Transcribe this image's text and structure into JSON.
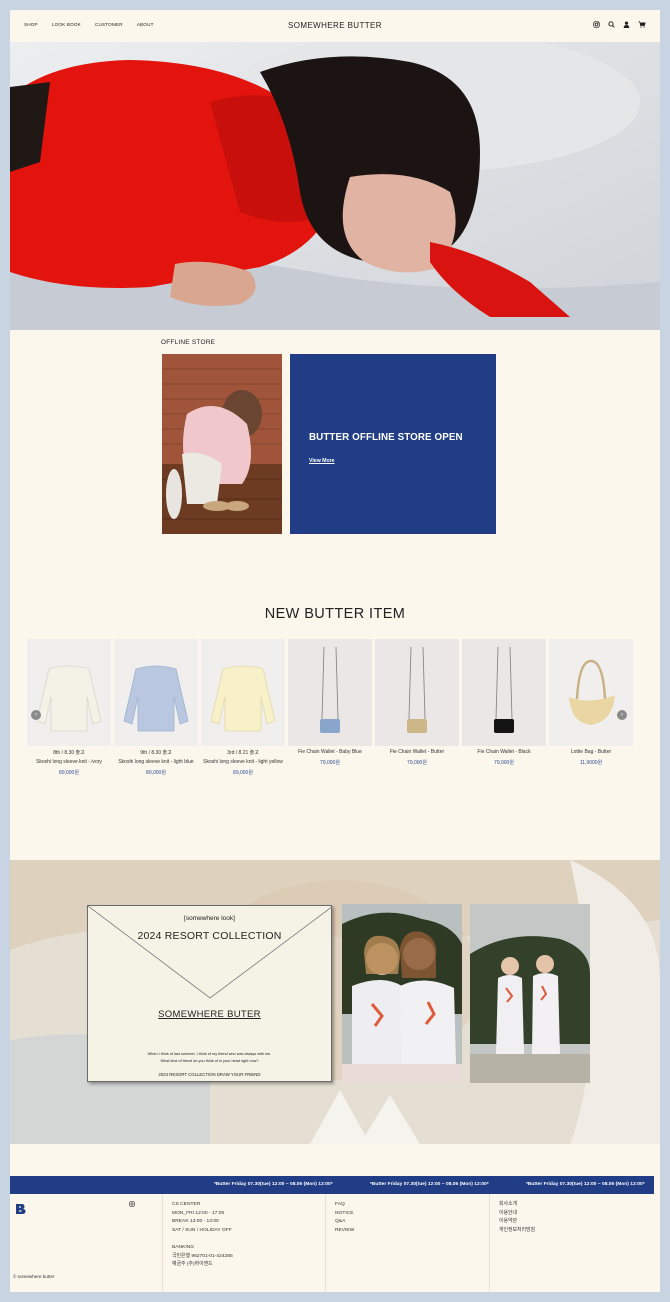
{
  "header": {
    "nav": [
      "SHOP",
      "LOOK BOOK",
      "CUSTOMER",
      "ABOUT"
    ],
    "brand": "SOMEWHERE BUTTER",
    "icons": [
      "instagram-icon",
      "search-icon",
      "user-icon",
      "cart-icon"
    ]
  },
  "offline": {
    "title": "OFFLINE STORE",
    "card_title": "BUTTER OFFLINE STORE OPEN",
    "card_link": "View More"
  },
  "new_items": {
    "title": "NEW BUTTER ITEM",
    "items": [
      {
        "line1": "8th / 8.30 출고",
        "line2": "Skoshi long sleeve knit - ivory",
        "price": "89,000원"
      },
      {
        "line1": "9th / 8.30 출고",
        "line2": "Skoshi long sleeve knit - light blue",
        "price": "89,000원"
      },
      {
        "line1": "3rd / 8.21 출고",
        "line2": "Skoshi long sleeve knit - light yellow",
        "price": "89,000원"
      },
      {
        "line1": "Fie Chain Wallet - Baby Blue",
        "line2": "",
        "price": "79,000원"
      },
      {
        "line1": "Fie Chain Wallet - Butter",
        "line2": "",
        "price": "79,000원"
      },
      {
        "line1": "Fie Chain Wallet - Black",
        "line2": "",
        "price": "79,000원"
      },
      {
        "line1": "Lottie Bag - Butter",
        "line2": "",
        "price": "11,9000원"
      }
    ]
  },
  "lookbook": {
    "tag": "[somewhere look]",
    "collection": "2024 RESORT COLLECTION",
    "brand_line": "SOMEWHERE BUTER",
    "quote1": "When I think of last summer, I think of my friend who was always with me.",
    "quote2": "What kind of friend do you think of in your head right now?",
    "draw": "2024 RESORT COLLECTION DRAW YOUR FRIEND"
  },
  "ticker": {
    "text": "*Butter Friday 07.30(tue) 12:00 ~ 08.05 (Mon) 12:00*"
  },
  "footer": {
    "copyright": "© somewhere butter",
    "cs": [
      "CS CENTER",
      "MON_FRI 12:00 - 17:00",
      "BREAK 13:00 - 14:00",
      "SAT / SUN / HOLIDAY OFF",
      "",
      "BANKING",
      "국민은행 962701-01-424285",
      "예금주 (주)하이엔드"
    ],
    "links": [
      "FAQ",
      "NOTICE",
      "Q&A",
      "REVIEW"
    ],
    "legal": [
      "회사소개",
      "이용안내",
      "이용약관",
      "개인정보처리방침"
    ]
  },
  "colors": {
    "background": "#fbf7ec",
    "accent_blue": "#213d85",
    "price_blue": "#2d4b94",
    "frame": "#c9d4e3"
  }
}
